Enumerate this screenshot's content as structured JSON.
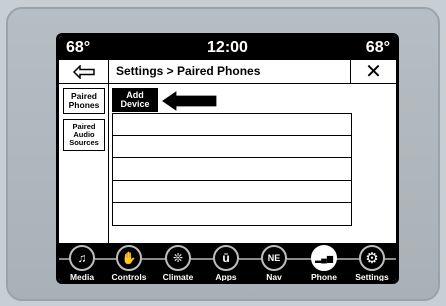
{
  "status": {
    "temp_left": "68°",
    "clock": "12:00",
    "temp_right": "68°"
  },
  "header": {
    "breadcrumb": "Settings > Paired Phones",
    "close_symbol": "✕"
  },
  "side_nav": [
    {
      "label": "Paired Phones"
    },
    {
      "label": "Paired Audio Sources"
    }
  ],
  "content": {
    "add_device_label": "Add Device",
    "list_rows": 5
  },
  "bottom_nav": [
    {
      "label": "Media",
      "icon": "music-note-icon",
      "glyph": "♫"
    },
    {
      "label": "Controls",
      "icon": "seat-controls-icon",
      "glyph": "✋"
    },
    {
      "label": "Climate",
      "icon": "climate-fan-icon",
      "glyph": "❊"
    },
    {
      "label": "Apps",
      "icon": "apps-icon",
      "glyph": "ū"
    },
    {
      "label": "Nav",
      "icon": "compass-icon",
      "glyph": "NE"
    },
    {
      "label": "Phone",
      "icon": "phone-signal-icon",
      "glyph": "▂▄▆"
    },
    {
      "label": "Settings",
      "icon": "gear-icon",
      "glyph": "⚙"
    }
  ],
  "active_nav": "Phone"
}
